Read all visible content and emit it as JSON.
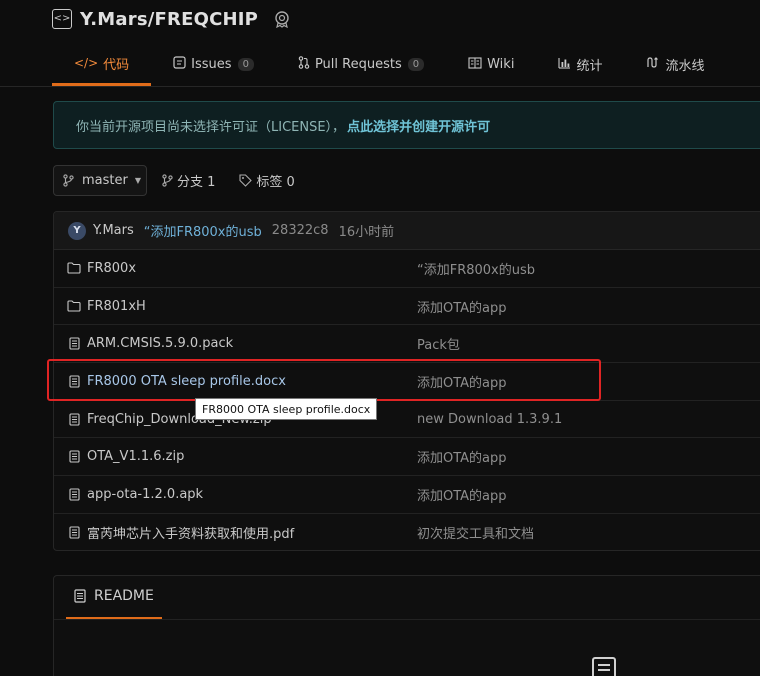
{
  "repo": {
    "title": "Y.Mars/FREQCHIP",
    "icon": "repo-icon",
    "badge_icon": "certified-badge-icon"
  },
  "tabs": [
    {
      "label": "代码",
      "icon": "code-icon",
      "active": true
    },
    {
      "label": "Issues",
      "icon": "issues-icon",
      "count": "0"
    },
    {
      "label": "Pull Requests",
      "icon": "pull-request-icon",
      "count": "0"
    },
    {
      "label": "Wiki",
      "icon": "wiki-icon"
    },
    {
      "label": "统计",
      "icon": "chart-icon"
    },
    {
      "label": "流水线",
      "icon": "pipeline-icon"
    }
  ],
  "notice": {
    "text": "你当前开源项目尚未选择许可证（LICENSE），",
    "link": "点此选择并创建开源许可"
  },
  "branch": {
    "current": "master",
    "branches_label": "分支 1",
    "tags_label": "标签 0"
  },
  "latest_commit": {
    "avatar_letter": "Y",
    "author": "Y.Mars",
    "message": "“添加FR800x的usb",
    "sha": "28322c8",
    "time": "16小时前"
  },
  "files": [
    {
      "name": "FR800x",
      "type": "folder",
      "commit": "“添加FR800x的usb"
    },
    {
      "name": "FR801xH",
      "type": "folder",
      "commit": "添加OTA的app"
    },
    {
      "name": "ARM.CMSIS.5.9.0.pack",
      "type": "file",
      "commit": "Pack包"
    },
    {
      "name": "FR8000 OTA sleep profile.docx",
      "type": "file",
      "commit": "添加OTA的app"
    },
    {
      "name": "FreqChip_Download_New.zip",
      "type": "file",
      "commit": "new Download 1.3.9.1"
    },
    {
      "name": "OTA_V1.1.6.zip",
      "type": "file",
      "commit": "添加OTA的app"
    },
    {
      "name": "app-ota-1.2.0.apk",
      "type": "file",
      "commit": "添加OTA的app"
    },
    {
      "name": "富芮坤芯片入手资料获取和使用.pdf",
      "type": "file",
      "commit": "初次提交工具和文档"
    }
  ],
  "tooltip": "FR8000 OTA sleep profile.docx",
  "readme": {
    "label": "README"
  },
  "colors": {
    "accent": "#e06c1a",
    "highlight": "#e02424",
    "link": "#6fc3d6"
  }
}
